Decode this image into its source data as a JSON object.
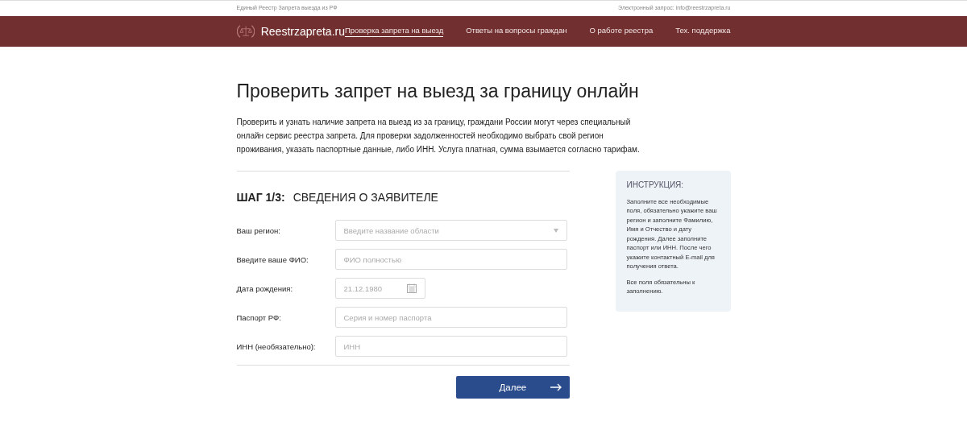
{
  "topbar": {
    "left": "Единый Реестр Запрета выезда из РФ",
    "right": "Электронный запрос: info@reestrzapreta.ru"
  },
  "brand": "Reestrzapreta.ru",
  "nav": [
    {
      "label": "Проверка запрета на выезд",
      "selected": true
    },
    {
      "label": "Ответы на вопросы граждан",
      "selected": false
    },
    {
      "label": "О работе реестра",
      "selected": false
    },
    {
      "label": "Тех. поддержка",
      "selected": false
    }
  ],
  "heading": "Проверить запрет на выезд за границу онлайн",
  "intro": "Проверить и узнать наличие запрета на выезд из за границу, граждани России могут через специальный онлайн сервис реестра запрета. Для проверки задолженностей необходимо выбрать свой регион проживания, указать паспортные данные, либо ИНН. Услуга платная, сумма взымается согласно тарифам.",
  "step": {
    "number": "ШАГ 1/3:",
    "title": "СВЕДЕНИЯ О ЗАЯВИТЕЛЕ"
  },
  "fields": [
    {
      "label": "Ваш регион:",
      "kind": "select",
      "placeholder": "Введите название области"
    },
    {
      "label": "Введите ваше ФИО:",
      "kind": "text",
      "placeholder": "ФИО полностью"
    },
    {
      "label": "Дата рождения:",
      "kind": "date",
      "placeholder": "21.12.1980"
    },
    {
      "label": "Паспорт РФ:",
      "kind": "text",
      "placeholder": "Серия и номер паспорта"
    },
    {
      "label": "ИНН (необязательно):",
      "kind": "text",
      "placeholder": "ИНН"
    }
  ],
  "next_button": "Далее",
  "instruction": {
    "title": "ИНСТРУКЦИЯ:",
    "paragraphs": [
      "Заполните все необходимые поля, обязательно укажите ваш регион и заполните Фамилию, Имя и Отчество и дату рождения. Далее заполните паспорт или ИНН. После чего укажите контактный E-mail для получения ответа.",
      "Все поля обязательны к заполнению."
    ]
  }
}
